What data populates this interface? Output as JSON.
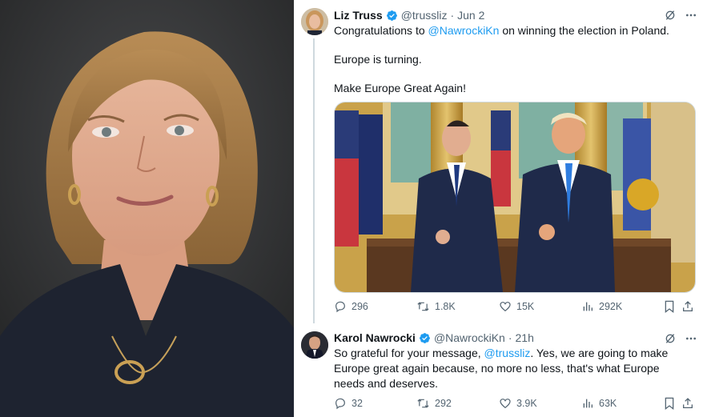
{
  "tweets": [
    {
      "name": "Liz Truss",
      "handle": "@trussliz",
      "sep": "·",
      "date": "Jun 2",
      "text_line1_prefix": "Congratulations to ",
      "text_line1_mention": "@NawrockiKn",
      "text_line1_suffix": " on winning the election in Poland.",
      "text_line2": "Europe is turning.",
      "text_line3": "Make Europe Great Again!",
      "stats": {
        "replies": "296",
        "reposts": "1.8K",
        "likes": "15K",
        "views": "292K"
      }
    },
    {
      "name": "Karol Nawrocki",
      "handle": "@NawrockiKn",
      "sep": "·",
      "date": "21h",
      "text_prefix": "So grateful for your message, ",
      "text_mention": "@trussliz",
      "text_suffix": ". Yes, we are going to make Europe great again because, no more no less, that's what Europe needs and deserves.",
      "stats": {
        "replies": "32",
        "reposts": "292",
        "likes": "3.9K",
        "views": "63K"
      }
    }
  ],
  "colors": {
    "accent": "#1d9bf0",
    "muted": "#536471",
    "text": "#0f1419"
  },
  "icons": [
    "verified-badge-icon",
    "grok-icon",
    "more-icon",
    "reply-icon",
    "repost-icon",
    "like-icon",
    "views-icon",
    "bookmark-icon",
    "share-icon"
  ]
}
